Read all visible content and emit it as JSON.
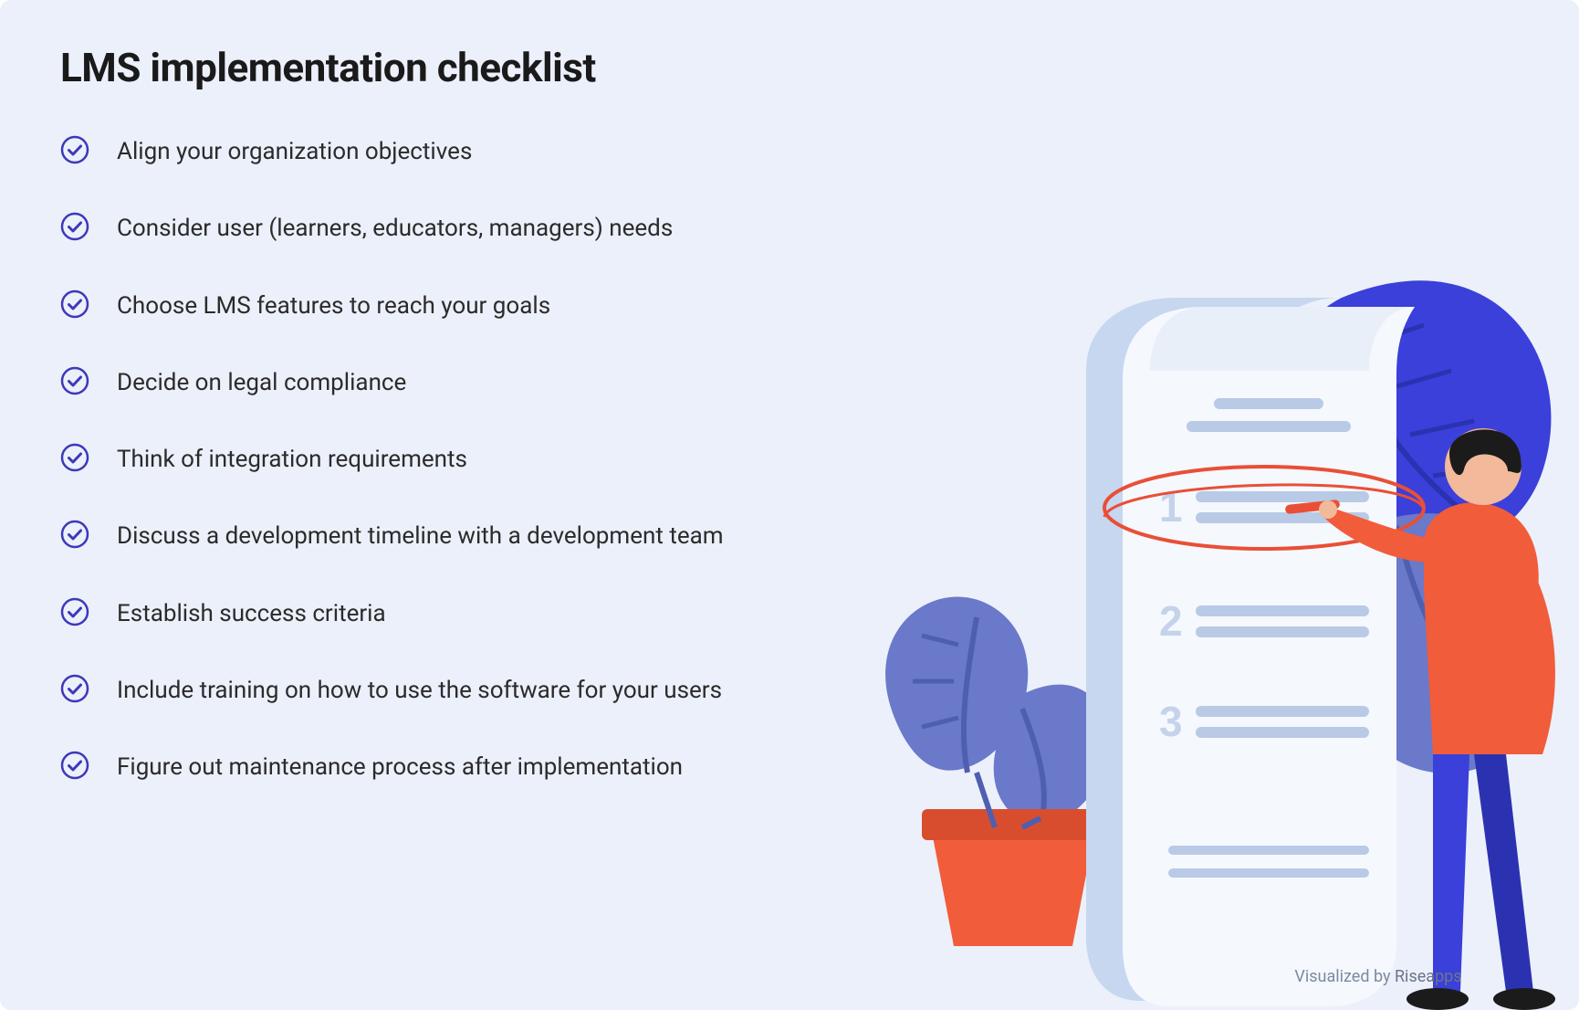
{
  "title": "LMS implementation checklist",
  "items": [
    "Align your organization objectives",
    "Consider user (learners, educators, managers) needs",
    "Choose LMS features to reach your goals",
    "Decide on legal compliance",
    "Think of integration requirements",
    "Discuss a development timeline with a development team",
    "Establish success criteria",
    "Include training on how to use the software for your users",
    "Figure out maintenance process after implementation"
  ],
  "credit_prefix": "Visualized by ",
  "credit_brand": "Riseapps",
  "colors": {
    "accent": "#3c39bb",
    "bg": "#ecf0fa",
    "text": "#2b2b2b",
    "orange": "#f15c3b",
    "blue": "#3a40d9",
    "leaf": "#6a79c9",
    "paper_line": "#b8cae6",
    "paper_num": "#c4d3ea",
    "ellipse": "#e94f37"
  }
}
